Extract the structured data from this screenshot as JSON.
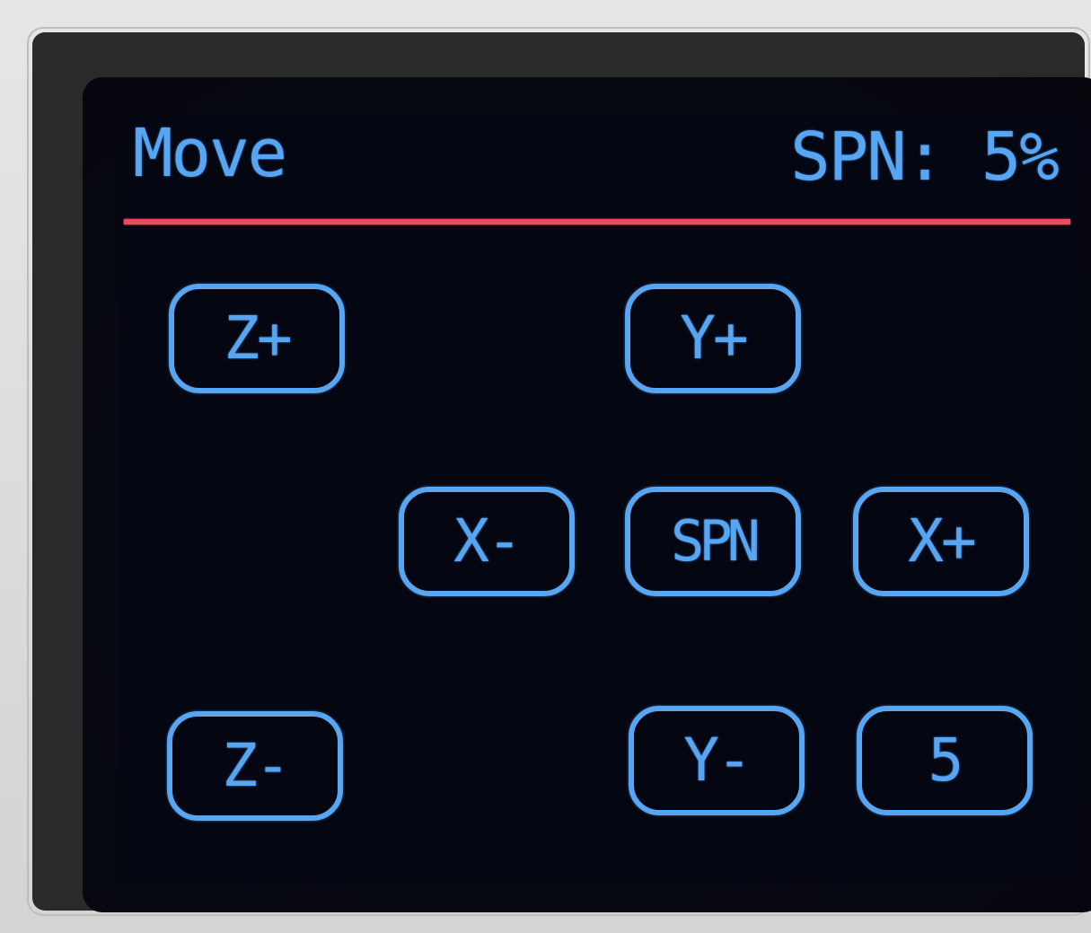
{
  "header": {
    "title": "Move",
    "status": "SPN: 5%"
  },
  "colors": {
    "text_accent": "#58a6f2",
    "divider": "#ec4d5b",
    "background": "#040611"
  },
  "buttons": {
    "z_plus": "Z+",
    "y_plus": "Y+",
    "x_minus": "X-",
    "spn": "SPN",
    "x_plus": "X+",
    "z_minus": "Z-",
    "y_minus": "Y-",
    "step": "5"
  }
}
